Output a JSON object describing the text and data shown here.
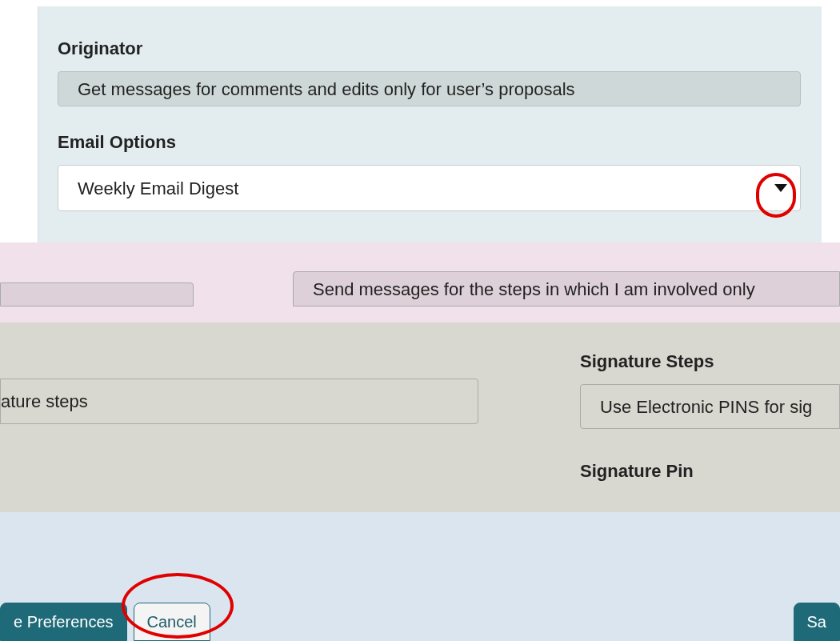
{
  "originator": {
    "label": "Originator",
    "value": "Get messages for comments and edits only for user’s proposals"
  },
  "email_options": {
    "label": "Email Options",
    "value": "Weekly Email Digest"
  },
  "step_messages": {
    "value": "Send messages for the steps in which I am involved only"
  },
  "left_field": {
    "value": "ature steps"
  },
  "signature_steps": {
    "label": "Signature Steps",
    "value": "Use Electronic PINS for sig"
  },
  "signature_pin": {
    "label": "Signature Pin"
  },
  "buttons": [
    {
      "label": "e Preferences",
      "kind": "primary"
    },
    {
      "label": "Cancel",
      "kind": "secondary"
    },
    {
      "label": "Sa",
      "kind": "primary"
    }
  ]
}
